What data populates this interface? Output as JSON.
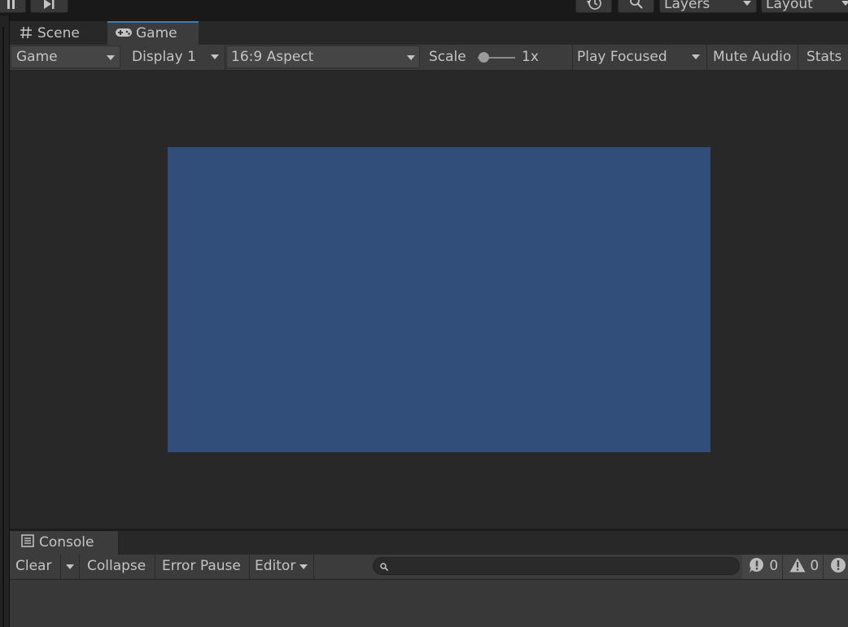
{
  "toolbar": {
    "pause_icon": "pause-icon",
    "step_icon": "step-icon",
    "history_icon": "history-icon",
    "search_icon": "search-icon",
    "layers_label": "Layers",
    "layout_label": "Layout"
  },
  "tabs": [
    {
      "label": "Scene",
      "icon": "grid-icon"
    },
    {
      "label": "Game",
      "icon": "gamepad-icon"
    }
  ],
  "game_toolbar": {
    "view_mode": "Game",
    "display": "Display 1",
    "aspect": "16:9 Aspect",
    "scale_label": "Scale",
    "scale_value": "1x",
    "play_mode": "Play Focused",
    "mute_label": "Mute Audio",
    "stats_label": "Stats"
  },
  "game_view": {
    "background_color": "#314d79"
  },
  "console": {
    "tab_label": "Console",
    "tab_icon": "console-icon",
    "clear_label": "Clear",
    "collapse_label": "Collapse",
    "error_pause_label": "Error Pause",
    "editor_label": "Editor",
    "search_placeholder": "",
    "info_count": "0",
    "warning_count": "0"
  }
}
